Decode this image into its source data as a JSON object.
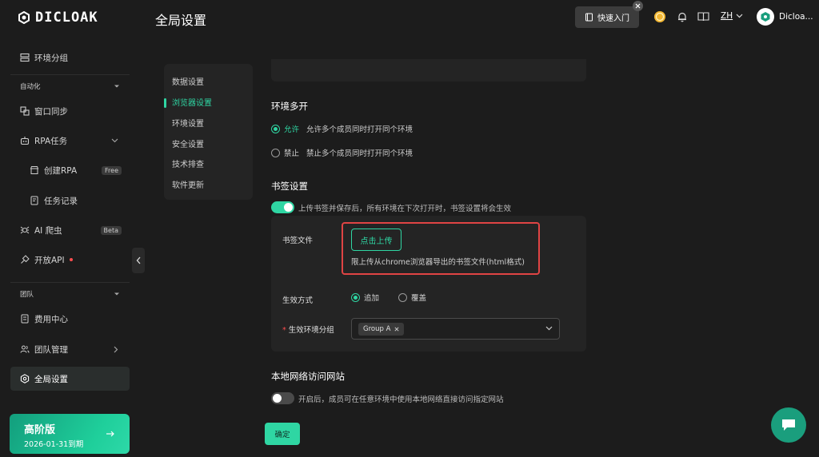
{
  "app": {
    "logo_text": "DICLOAK"
  },
  "header": {
    "page_title": "全局设置",
    "quick_start_label": "快速入门",
    "language": "ZH",
    "username": "Dicloa..."
  },
  "sidebar": {
    "env_group": "环境分组",
    "automation_section": "自动化",
    "window_sync": "窗口同步",
    "rpa_tasks": "RPA任务",
    "create_rpa": "创建RPA",
    "create_rpa_badge": "Free",
    "task_records": "任务记录",
    "ai_crawler": "AI 爬虫",
    "ai_crawler_badge": "Beta",
    "open_api": "开放API",
    "team_section": "团队",
    "billing_center": "费用中心",
    "team_management": "团队管理",
    "global_settings": "全局设置",
    "plan": {
      "title": "高阶版",
      "expiry": "2026-01-31到期"
    }
  },
  "settings_nav": {
    "items": [
      "数据设置",
      "浏览器设置",
      "环境设置",
      "安全设置",
      "技术排查",
      "软件更新"
    ],
    "active_index": 1
  },
  "multi_open": {
    "title": "环境多开",
    "allow_label": "允许",
    "allow_desc": "允许多个成员同时打开同个环境",
    "deny_label": "禁止",
    "deny_desc": "禁止多个成员同时打开同个环境",
    "selected": "allow"
  },
  "bookmarks": {
    "title": "书签设置",
    "enabled": true,
    "toggle_desc": "上传书签并保存后，所有环境在下次打开时，书签设置将会生效",
    "file_label": "书签文件",
    "upload_label": "点击上传",
    "upload_hint": "限上传从chrome浏览器导出的书签文件(html格式)",
    "mode_label": "生效方式",
    "mode_append": "追加",
    "mode_overwrite": "覆盖",
    "mode_selected": "append",
    "group_label": "生效环境分组",
    "group_tag": "Group A"
  },
  "local_network": {
    "title": "本地网络访问网站",
    "enabled": false,
    "toggle_desc": "开启后，成员可在任意环境中使用本地网络直接访问指定网站"
  },
  "actions": {
    "confirm_label": "确定"
  },
  "colors": {
    "accent": "#2fd6a3",
    "highlight": "#e04444",
    "background": "#1c1c1c"
  }
}
